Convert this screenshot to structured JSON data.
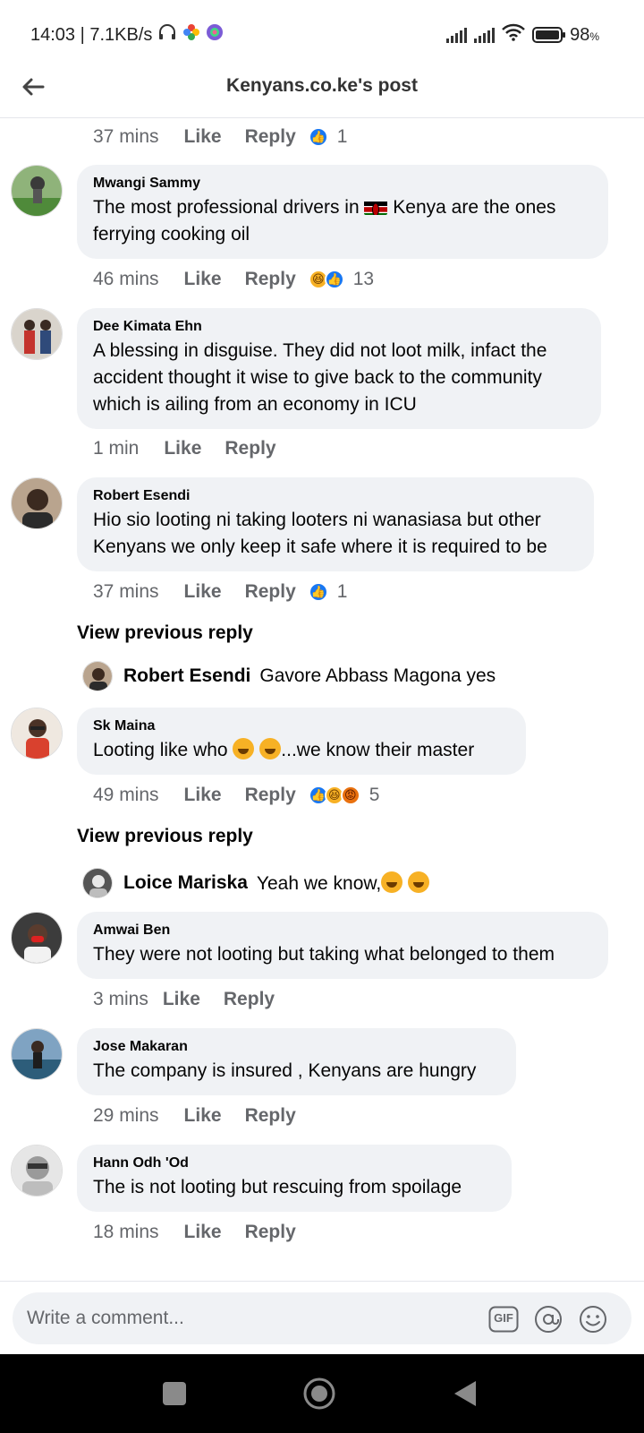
{
  "status_bar": {
    "time_speed": "14:03 | 7.1KB/s",
    "battery": "98",
    "battery_unit": "%"
  },
  "header": {
    "title": "Kenyans.co.ke's post"
  },
  "labels": {
    "like": "Like",
    "reply": "Reply",
    "view_previous_reply": "View previous reply"
  },
  "comments": [
    {
      "time": "37 mins",
      "reaction_count": "1"
    },
    {
      "name": "Mwangi Sammy",
      "text_before": "The most professional drivers in ",
      "text_after": " Kenya are the ones ferrying cooking oil",
      "time": "46 mins",
      "reaction_count": "13"
    },
    {
      "name": "Dee Kimata Ehn",
      "text": "A blessing in disguise. They did not loot milk, infact the accident thought it wise to give back to the community which is ailing from an economy in ICU",
      "time": "1 min"
    },
    {
      "name": "Robert Esendi",
      "text": "Hio sio looting ni taking looters ni wanasiasa but other Kenyans we only keep it safe where it is required to be",
      "time": "37 mins",
      "reaction_count": "1"
    },
    {
      "name": "Sk Maina",
      "text_before": "Looting like who ",
      "text_after": "...we know their master",
      "time": "49 mins",
      "reaction_count": "5"
    },
    {
      "name": "Amwai Ben",
      "text": "They were not looting but taking what belonged to them",
      "time": "3 mins"
    },
    {
      "name": "Jose Makaran",
      "text": "The company is insured , Kenyans are hungry",
      "time": "29 mins"
    },
    {
      "name": "Hann Odh 'Od",
      "text": "The is not looting but rescuing from spoilage",
      "time": "18 mins"
    }
  ],
  "replies": [
    {
      "name": "Robert Esendi",
      "text": "Gavore Abbass Magona yes"
    },
    {
      "name": "Loice Mariska",
      "text": "Yeah we know,"
    }
  ],
  "composer": {
    "placeholder": "Write a comment...",
    "gif_label": "GIF"
  },
  "colors": {
    "like_blue": "#1877f2",
    "haha_yellow": "#f7b125",
    "angry_orange": "#e9710f",
    "bubble_bg": "#f0f2f5",
    "meta_gray": "#65676b"
  },
  "icons": [
    "headphones-icon",
    "photos-icon",
    "browser-icon",
    "signal-icon",
    "wifi-icon",
    "battery-icon",
    "back-arrow-icon",
    "like-reaction-icon",
    "haha-reaction-icon",
    "angry-reaction-icon",
    "gif-icon",
    "mention-icon",
    "emoji-icon",
    "recents-icon",
    "home-icon",
    "back-nav-icon"
  ]
}
